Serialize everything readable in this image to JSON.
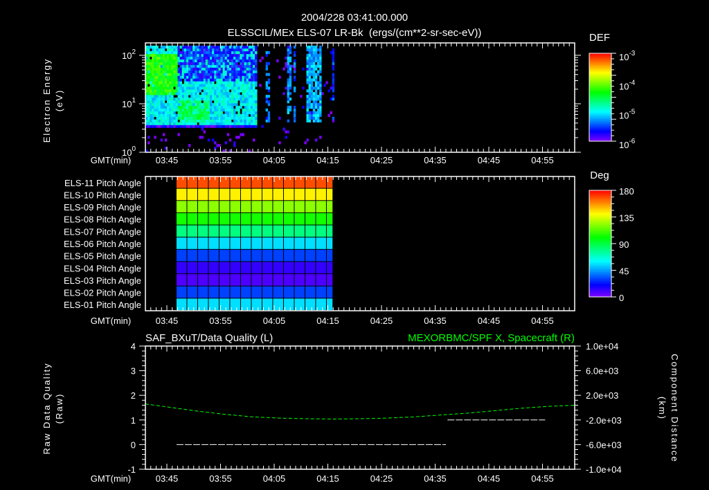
{
  "header": {
    "timestamp": "2004/228 03:41:00.000",
    "title": "ELSSCIL/MEx ELS-07 LR-Bk  (ergs/(cm**2-sr-sec-eV))"
  },
  "time_axis": {
    "label": "GMT(min)",
    "start": "03:41",
    "range_minutes": [
      0,
      80
    ],
    "ticks": [
      {
        "label": "03:45",
        "t": 4
      },
      {
        "label": "03:55",
        "t": 14
      },
      {
        "label": "04:05",
        "t": 24
      },
      {
        "label": "04:15",
        "t": 34
      },
      {
        "label": "04:25",
        "t": 44
      },
      {
        "label": "04:35",
        "t": 54
      },
      {
        "label": "04:45",
        "t": 64
      },
      {
        "label": "04:55",
        "t": 74
      }
    ]
  },
  "chart_data": [
    {
      "type": "heatmap",
      "name": "spectrogram",
      "ylabel": [
        "Electron Energy",
        "(eV)"
      ],
      "yscale": "log",
      "ylim": [
        1,
        180
      ],
      "yticks": [
        {
          "base": "10",
          "exp": "0",
          "v": 1
        },
        {
          "base": "10",
          "exp": "1",
          "v": 10
        },
        {
          "base": "10",
          "exp": "2",
          "v": 100
        }
      ],
      "colorbar": {
        "label": "DEF",
        "log_range": [
          -6,
          -3
        ],
        "ticks": [
          {
            "base": "10",
            "exp": "-3",
            "v": -3
          },
          {
            "base": "10",
            "exp": "-4",
            "v": -4
          },
          {
            "base": "10",
            "exp": "-5",
            "v": -5
          },
          {
            "base": "10",
            "exp": "-6",
            "v": -6
          }
        ]
      },
      "regions_minutes_eV_logDEF": [
        {
          "t": [
            0,
            20.5
          ],
          "e": [
            3.5,
            150
          ],
          "v": -5.0,
          "fill": 0.95
        },
        {
          "t": [
            0,
            6
          ],
          "e": [
            15,
            110
          ],
          "v": -4.3,
          "fill": 0.95
        },
        {
          "t": [
            6,
            12
          ],
          "e": [
            4,
            12
          ],
          "v": -4.6,
          "fill": 0.9
        },
        {
          "t": [
            6,
            20.5
          ],
          "e": [
            30,
            150
          ],
          "v": -5.6,
          "fill": 0.7
        },
        {
          "t": [
            0,
            20.5
          ],
          "e": [
            3.2,
            3.8
          ],
          "v": -5.8,
          "fill": 1.0
        },
        {
          "t": [
            0,
            21
          ],
          "e": [
            1,
            3.2
          ],
          "v": -5.9,
          "fill": 0.06
        },
        {
          "t": [
            21,
            35
          ],
          "e": [
            1.5,
            150
          ],
          "v": -5.9,
          "fill": 0.05
        },
        {
          "t": [
            22.3,
            23
          ],
          "e": [
            4,
            120
          ],
          "v": -5.4,
          "fill": 0.6
        },
        {
          "t": [
            26.2,
            26.8
          ],
          "e": [
            4,
            150
          ],
          "v": -5.3,
          "fill": 0.7
        },
        {
          "t": [
            27.2,
            27.8
          ],
          "e": [
            4,
            150
          ],
          "v": -5.4,
          "fill": 0.6
        },
        {
          "t": [
            29.8,
            32.5
          ],
          "e": [
            4,
            150
          ],
          "v": -5.2,
          "fill": 0.85
        },
        {
          "t": [
            34.6,
            35.1
          ],
          "e": [
            4.5,
            150
          ],
          "v": -5.5,
          "fill": 0.7
        }
      ]
    },
    {
      "type": "heatmap",
      "name": "pitch-angle",
      "colorbar": {
        "label": "Deg",
        "range": [
          0,
          180
        ],
        "ticks": [
          "180",
          "135",
          "90",
          "45",
          "0"
        ]
      },
      "time_span_minutes": [
        5.8,
        35
      ],
      "column_minutes": 2,
      "rows": [
        {
          "label": "ELS-11 Pitch Angle",
          "deg": 168
        },
        {
          "label": "ELS-10 Pitch Angle",
          "deg": 142
        },
        {
          "label": "ELS-09 Pitch Angle",
          "deg": 122
        },
        {
          "label": "ELS-08 Pitch Angle",
          "deg": 103
        },
        {
          "label": "ELS-07 Pitch Angle",
          "deg": 80
        },
        {
          "label": "ELS-06 Pitch Angle",
          "deg": 55
        },
        {
          "label": "ELS-05 Pitch Angle",
          "deg": 30
        },
        {
          "label": "ELS-04 Pitch Angle",
          "deg": 12
        },
        {
          "label": "ELS-03 Pitch Angle",
          "deg": 8
        },
        {
          "label": "ELS-02 Pitch Angle",
          "deg": 30
        },
        {
          "label": "ELS-01 Pitch Angle",
          "deg": 55
        }
      ]
    },
    {
      "type": "line",
      "name": "quality-and-distance",
      "left_title": "SAF_BXuT/Data Quality (L)",
      "right_title": "MEXORBMC/SPF X, Spacecraft (R)",
      "left_ylabel": [
        "Raw Data Quality",
        "(Raw)"
      ],
      "right_ylabel": [
        "Component Distance",
        "(km)"
      ],
      "left_ylim": [
        -1,
        4
      ],
      "left_ticks": [
        "4",
        "3",
        "2",
        "1",
        "0",
        "-1"
      ],
      "right_ylim": [
        -10000,
        10000
      ],
      "right_ticks": [
        "1.0e+04",
        "6.0e+03",
        "2.0e+03",
        "-2.0e+03",
        "-6.0e+03",
        "-1.0e+04"
      ],
      "series": [
        {
          "name": "Data Quality",
          "color": "#ffffff",
          "axis": "left",
          "segments": [
            {
              "t": [
                5.8,
                56
              ],
              "v": 0
            },
            {
              "t": [
                56.3,
                74.5
              ],
              "v": 1
            }
          ]
        },
        {
          "name": "SPF X",
          "color": "#00ff00",
          "axis": "right",
          "t": [
            0,
            5,
            10,
            15,
            20,
            25,
            30,
            35,
            40,
            45,
            50,
            55,
            60,
            65,
            70,
            75,
            80
          ],
          "v": [
            600,
            0,
            -600,
            -1100,
            -1500,
            -1700,
            -1800,
            -1850,
            -1800,
            -1700,
            -1500,
            -1200,
            -900,
            -500,
            -100,
            200,
            400
          ]
        }
      ]
    }
  ]
}
